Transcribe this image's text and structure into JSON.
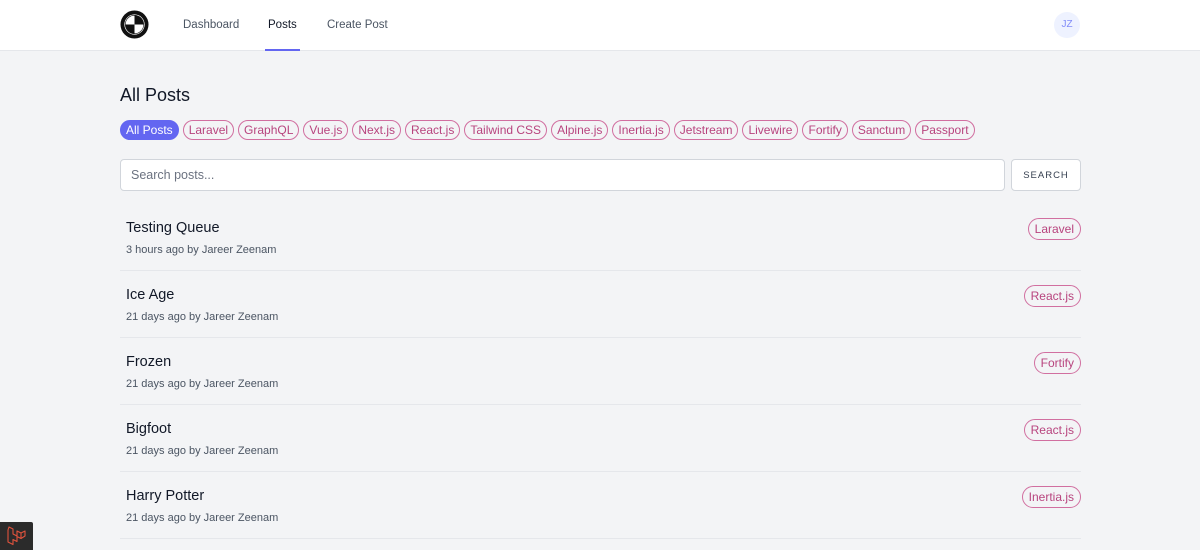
{
  "nav": {
    "links": [
      "Dashboard",
      "Posts",
      "Create Post"
    ],
    "active": "Posts",
    "avatar_initials": "JZ"
  },
  "page": {
    "title": "All Posts"
  },
  "tag_filters": [
    "All Posts",
    "Laravel",
    "GraphQL",
    "Vue.js",
    "Next.js",
    "React.js",
    "Tailwind CSS",
    "Alpine.js",
    "Inertia.js",
    "Jetstream",
    "Livewire",
    "Fortify",
    "Sanctum",
    "Passport"
  ],
  "search": {
    "placeholder": "Search posts...",
    "button_label": "SEARCH"
  },
  "posts": [
    {
      "title": "Testing Queue",
      "meta": "3 hours ago by Jareer Zeenam",
      "tag": "Laravel"
    },
    {
      "title": "Ice Age",
      "meta": "21 days ago by Jareer Zeenam",
      "tag": "React.js"
    },
    {
      "title": "Frozen",
      "meta": "21 days ago by Jareer Zeenam",
      "tag": "Fortify"
    },
    {
      "title": "Bigfoot",
      "meta": "21 days ago by Jareer Zeenam",
      "tag": "React.js"
    },
    {
      "title": "Harry Potter",
      "meta": "21 days ago by Jareer Zeenam",
      "tag": "Inertia.js"
    }
  ],
  "colors": {
    "accent": "#6366f1",
    "tag_border": "#d16fa0",
    "tag_text": "#b8447e",
    "background": "#f3f4f6"
  },
  "icons": {
    "logo": "roundel-logo-icon",
    "corner": "laravel-icon"
  }
}
